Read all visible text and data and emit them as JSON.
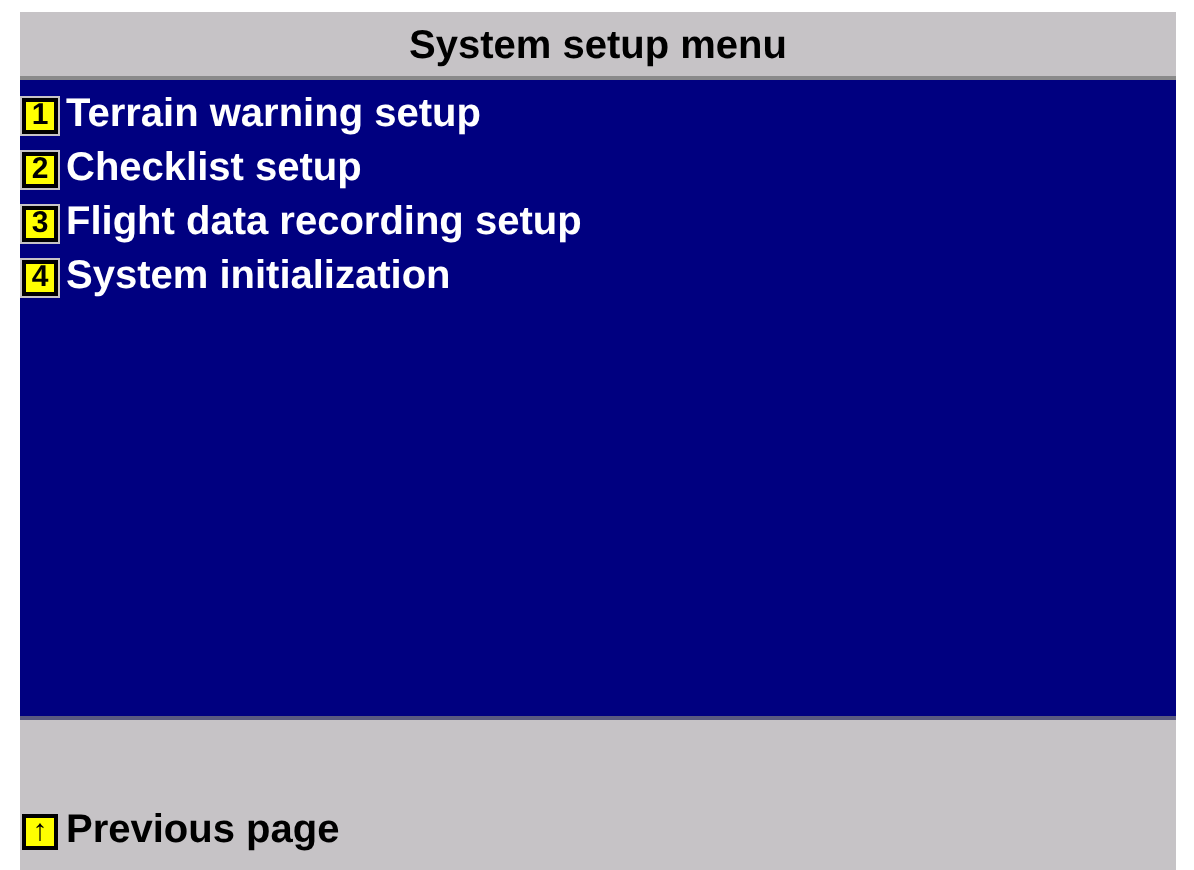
{
  "title": "System setup menu",
  "menu_items": [
    {
      "key": "1",
      "label": "Terrain warning setup"
    },
    {
      "key": "2",
      "label": "Checklist setup"
    },
    {
      "key": "3",
      "label": "Flight data recording setup"
    },
    {
      "key": "4",
      "label": "System initialization"
    }
  ],
  "footer": {
    "key": "↑",
    "label": "Previous page"
  }
}
